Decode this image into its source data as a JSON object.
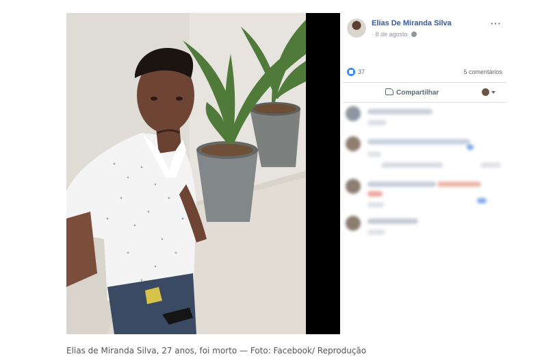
{
  "post": {
    "author": "Elias De Miranda Silva",
    "date": "8 de agosto",
    "date_prefix": "·",
    "more": "···",
    "likes": "37",
    "comments": "5 comentários",
    "share": "Compartilhar"
  },
  "icons": [
    "globe-icon",
    "like-icon",
    "share-icon",
    "more-icon",
    "chevron-down-icon"
  ],
  "colors": {
    "author_link": "#385898",
    "like_blue": "#2d88ff",
    "muted_text": "#606770"
  },
  "caption": "Elias de Miranda Silva, 27 anos, foi morto — Foto: Facebook/ Reprodução"
}
